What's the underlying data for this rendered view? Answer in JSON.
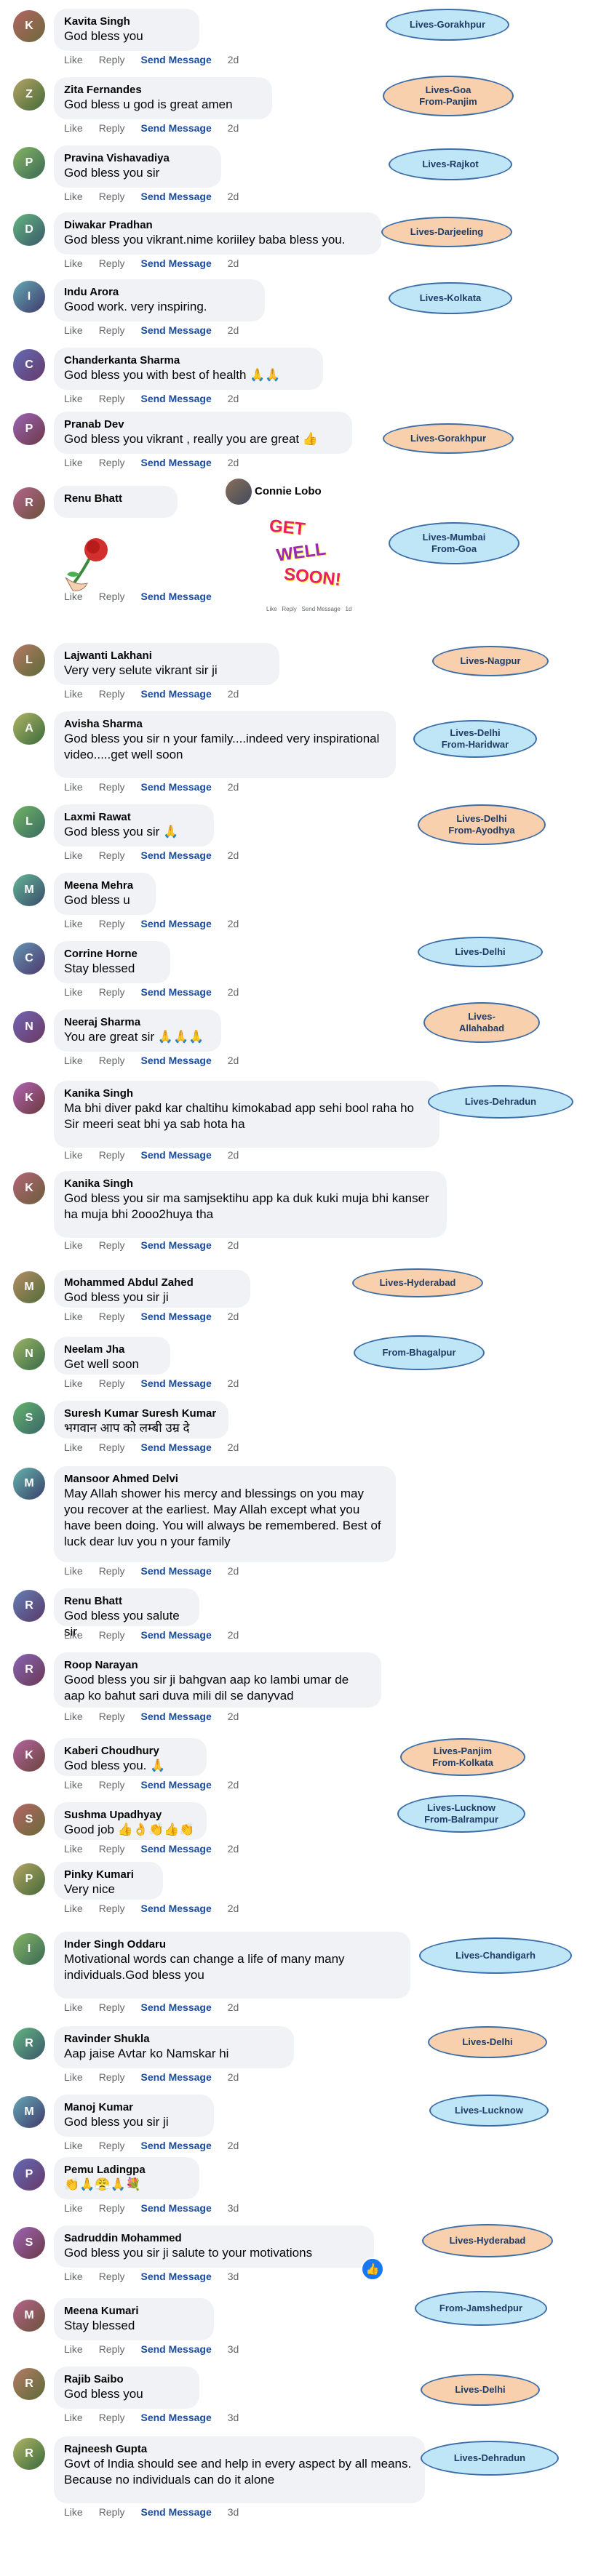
{
  "actions": {
    "like": "Like",
    "reply": "Reply",
    "send": "Send Message"
  },
  "comments": [
    {
      "name": "Kavita Singh",
      "text": "God bless you",
      "time": "2d",
      "initial": "K",
      "tag": "Lives-Gorakhpur",
      "tag_color": "blue"
    },
    {
      "name": "Zita Fernandes",
      "text": "God bless u god is great amen",
      "time": "2d",
      "initial": "Z",
      "tag": "Lives-Goa\nFrom-Panjim",
      "tag_color": "orange"
    },
    {
      "name": "Pravina Vishavadiya",
      "text": "God bless you sir",
      "time": "2d",
      "initial": "P",
      "tag": "Lives-Rajkot",
      "tag_color": "blue"
    },
    {
      "name": "Diwakar Pradhan",
      "text": "God bless you vikrant.nime koriiley baba bless you.",
      "time": "2d",
      "initial": "D",
      "tag": "Lives-Darjeeling",
      "tag_color": "orange"
    },
    {
      "name": "Indu Arora",
      "text": "Good work. very inspiring.",
      "time": "2d",
      "initial": "I",
      "tag": "Lives-Kolkata",
      "tag_color": "blue"
    },
    {
      "name": "Chanderkanta Sharma",
      "text": "God bless you with best of health 🙏🙏",
      "time": "2d",
      "initial": "C",
      "tag": "",
      "tag_color": ""
    },
    {
      "name": "Pranab Dev",
      "text": "God bless you vikrant , really you are great 👍",
      "time": "2d",
      "initial": "P",
      "tag": "Lives-Gorakhpur",
      "tag_color": "orange"
    },
    {
      "name": "Renu Bhatt",
      "text": "",
      "time": "",
      "initial": "R",
      "tag": "Lives-Mumbai\nFrom-Goa",
      "tag_color": "blue",
      "sticker": "rose",
      "overlap_name": "Connie Lobo",
      "get_well": [
        "GET",
        "WELL",
        "SOON!"
      ],
      "mini_actions": "Like   Reply   Send Message   1d"
    },
    {
      "name": "Lajwanti Lakhani",
      "text": "Very very selute vikrant sir ji",
      "time": "2d",
      "initial": "L",
      "tag": "Lives-Nagpur",
      "tag_color": "orange"
    },
    {
      "name": "Avisha Sharma",
      "text": "God bless you sir n your family....indeed very inspirational video.....get well soon",
      "time": "2d",
      "initial": "A",
      "tag": "Lives-Delhi\nFrom-Haridwar",
      "tag_color": "blue"
    },
    {
      "name": "Laxmi Rawat",
      "text": "God bless you sir 🙏",
      "time": "2d",
      "initial": "L",
      "tag": "Lives-Delhi\nFrom-Ayodhya",
      "tag_color": "orange"
    },
    {
      "name": "Meena Mehra",
      "text": "God bless u",
      "time": "2d",
      "initial": "M",
      "tag": "",
      "tag_color": ""
    },
    {
      "name": "Corrine Horne",
      "text": "Stay blessed",
      "time": "2d",
      "initial": "C",
      "tag": "Lives-Delhi",
      "tag_color": "blue"
    },
    {
      "name": "Neeraj Sharma",
      "text": "You are great sir 🙏🙏🙏",
      "time": "2d",
      "initial": "N",
      "tag": "Lives-\nAllahabad",
      "tag_color": "orange"
    },
    {
      "name": "Kanika Singh",
      "text": "Ma bhi diver pakd kar chaltihu kimokabad app sehi bool raha ho Sir meeri seat bhi ya sab hota ha",
      "time": "2d",
      "initial": "K",
      "tag": "Lives-Dehradun",
      "tag_color": "blue"
    },
    {
      "name": "Kanika Singh",
      "text": "God bless you sir ma samjsektihu app ka duk kuki muja bhi kanser ha muja bhi 2ooo2huya tha",
      "time": "2d",
      "initial": "K",
      "tag": "",
      "tag_color": ""
    },
    {
      "name": "Mohammed Abdul Zahed",
      "text": "God bless you sir ji",
      "time": "2d",
      "initial": "M",
      "tag": "Lives-Hyderabad",
      "tag_color": "orange"
    },
    {
      "name": "Neelam Jha",
      "text": "Get well soon",
      "time": "2d",
      "initial": "N",
      "tag": "From-Bhagalpur",
      "tag_color": "blue"
    },
    {
      "name": "Suresh Kumar Suresh Kumar",
      "text": "भगवान आप को लम्बी उम्र दे",
      "time": "2d",
      "initial": "S",
      "tag": "",
      "tag_color": ""
    },
    {
      "name": "Mansoor Ahmed Delvi",
      "text": "May Allah shower his mercy and blessings on you may you recover at the earliest. May Allah except what you have been doing. You will always be remembered. Best of luck dear luv you n your family",
      "time": "2d",
      "initial": "M",
      "tag": "",
      "tag_color": ""
    },
    {
      "name": "Renu Bhatt",
      "text": "God bless you salute sir.",
      "time": "2d",
      "initial": "R",
      "tag": "",
      "tag_color": ""
    },
    {
      "name": "Roop Narayan",
      "text": "Good bless you sir ji bahgvan aap ko lambi umar de aap ko bahut sari duva mili dil se danyvad",
      "time": "2d",
      "initial": "R",
      "tag": "",
      "tag_color": ""
    },
    {
      "name": "Kaberi Choudhury",
      "text": "God bless you. 🙏",
      "time": "2d",
      "initial": "K",
      "tag": "Lives-Panjim\nFrom-Kolkata",
      "tag_color": "orange"
    },
    {
      "name": "Sushma Upadhyay",
      "text": "Good job 👍👌👏👍👏",
      "time": "2d",
      "initial": "S",
      "tag": "Lives-Lucknow\nFrom-Balrampur",
      "tag_color": "blue"
    },
    {
      "name": "Pinky Kumari",
      "text": "Very nice",
      "time": "2d",
      "initial": "P",
      "tag": "",
      "tag_color": ""
    },
    {
      "name": "Inder Singh Oddaru",
      "text": "Motivational words can change a life of many many individuals.God bless you",
      "time": "2d",
      "initial": "I",
      "tag": "Lives-Chandigarh",
      "tag_color": "blue"
    },
    {
      "name": "Ravinder Shukla",
      "text": "Aap jaise Avtar ko Namskar hi",
      "time": "2d",
      "initial": "R",
      "tag": "Lives-Delhi",
      "tag_color": "orange"
    },
    {
      "name": "Manoj Kumar",
      "text": "God bless you sir ji",
      "time": "2d",
      "initial": "M",
      "tag": "Lives-Lucknow",
      "tag_color": "blue"
    },
    {
      "name": "Pemu Ladingpa",
      "text": "👏🙏😤🙏💐",
      "time": "3d",
      "initial": "P",
      "tag": "",
      "tag_color": ""
    },
    {
      "name": "Sadruddin Mohammed",
      "text": "God bless you sir ji salute to your motivations",
      "time": "3d",
      "initial": "S",
      "tag": "Lives-Hyderabad",
      "tag_color": "orange",
      "react": true
    },
    {
      "name": "Meena Kumari",
      "text": "Stay blessed",
      "time": "3d",
      "initial": "M",
      "tag": "From-Jamshedpur",
      "tag_color": "blue"
    },
    {
      "name": "Rajib Saibo",
      "text": "God bless you",
      "time": "3d",
      "initial": "R",
      "tag": "Lives-Delhi",
      "tag_color": "orange"
    },
    {
      "name": "Rajneesh Gupta",
      "text": "Govt of India should see and help in every aspect by all means. Because no individuals can do it alone",
      "time": "3d",
      "initial": "R",
      "tag": "Lives-Dehradun",
      "tag_color": "blue"
    }
  ]
}
